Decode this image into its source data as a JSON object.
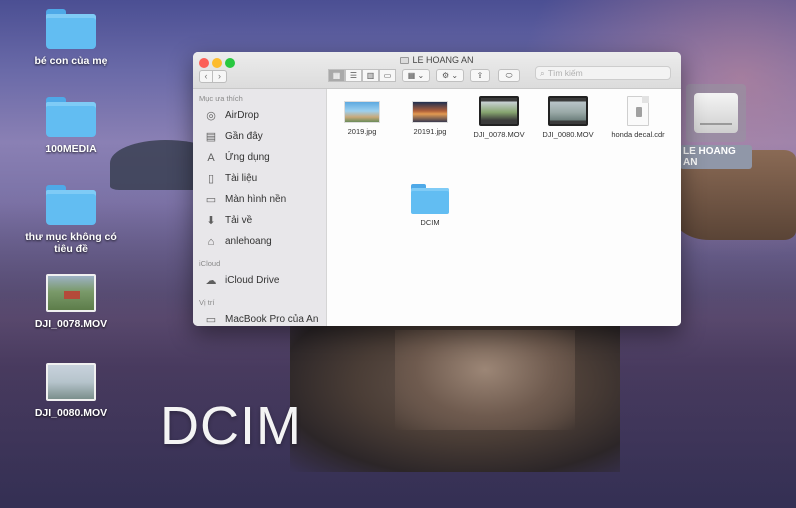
{
  "desktop": {
    "items": [
      {
        "label": "bé con của mẹ",
        "icon": "folder-icon"
      },
      {
        "label": "100MEDIA",
        "icon": "folder-icon"
      },
      {
        "label": "thư mục không có tiêu đề",
        "icon": "folder-icon"
      },
      {
        "label": "DJI_0078.MOV",
        "icon": "video-thumbnail"
      },
      {
        "label": "DJI_0080.MOV",
        "icon": "video-thumbnail"
      }
    ],
    "drive_label": "LE HOANG AN",
    "caption": "DCIM"
  },
  "window": {
    "title": "LE HOANG AN",
    "nav": {
      "back": "‹",
      "forward": "›"
    },
    "toolbar": {
      "view_icons": [
        "▦",
        "☰",
        "▥",
        "▭"
      ],
      "group_icon": "▦ ⌄",
      "action_icon": "⚙ ⌄",
      "share_icon": "⇪",
      "tag_icon": "⬭"
    },
    "search_placeholder": "Tìm kiếm",
    "sidebar": {
      "favorites_heading": "Mục ưa thích",
      "favorites": [
        {
          "label": "AirDrop",
          "icon": "airdrop-icon",
          "glyph": "◎"
        },
        {
          "label": "Gần đây",
          "icon": "recents-icon",
          "glyph": "▤"
        },
        {
          "label": "Ứng dụng",
          "icon": "applications-icon",
          "glyph": "A"
        },
        {
          "label": "Tài liệu",
          "icon": "documents-icon",
          "glyph": "▯"
        },
        {
          "label": "Màn hình nền",
          "icon": "desktop-icon",
          "glyph": "▭"
        },
        {
          "label": "Tải về",
          "icon": "downloads-icon",
          "glyph": "⬇"
        },
        {
          "label": "anlehoang",
          "icon": "home-icon",
          "glyph": "⌂"
        }
      ],
      "icloud_heading": "iCloud",
      "icloud": [
        {
          "label": "iCloud Drive",
          "icon": "cloud-icon",
          "glyph": "☁"
        }
      ],
      "locations_heading": "Vị trí",
      "locations": [
        {
          "label": "MacBook Pro của An",
          "icon": "laptop-icon",
          "glyph": "▭"
        }
      ]
    },
    "files": [
      {
        "name": "2019.jpg",
        "kind": "image"
      },
      {
        "name": "20191.jpg",
        "kind": "image"
      },
      {
        "name": "DJI_0078.MOV",
        "kind": "video"
      },
      {
        "name": "DJI_0080.MOV",
        "kind": "video"
      },
      {
        "name": "honda decal.cdr",
        "kind": "document"
      },
      {
        "name": "DCIM",
        "kind": "folder"
      }
    ]
  },
  "colors": {
    "folder": "#62bdf2",
    "close": "#fc5f57",
    "minimize": "#fdbc2e",
    "maximize": "#28c840"
  }
}
